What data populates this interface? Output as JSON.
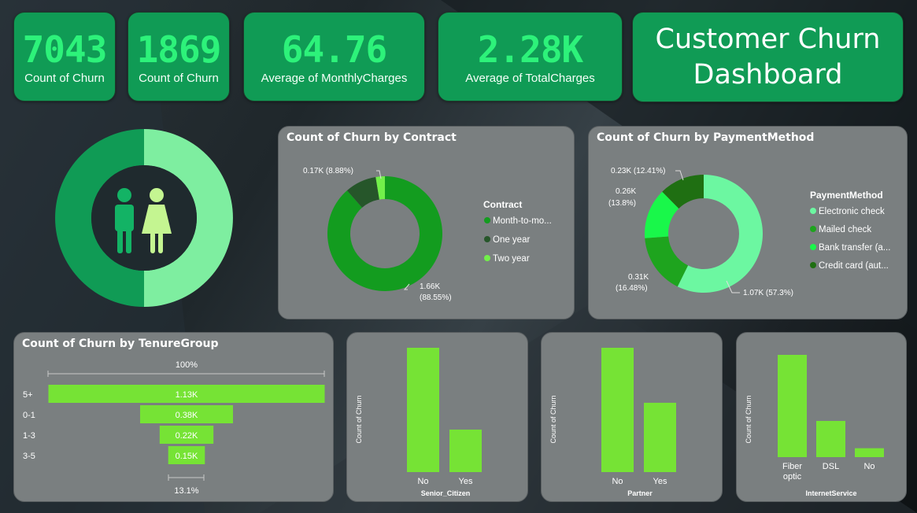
{
  "kpis": [
    {
      "value": "7043",
      "label": "Count of Churn"
    },
    {
      "value": "1869",
      "label": "Count of Churn"
    },
    {
      "value": "64.76",
      "label": "Average of MonthlyCharges"
    },
    {
      "value": "2.28K",
      "label": "Average of TotalCharges"
    }
  ],
  "title": {
    "line1": "Customer Churn",
    "line2": "Dashboard"
  },
  "colors": {
    "accent": "#109b55",
    "kpi_value": "#2df27a",
    "bar": "#76e335",
    "panel": "#7a7f80"
  },
  "icons": {
    "gender": "male-female-icon"
  },
  "chart_data": [
    {
      "type": "pie",
      "variant": "donut",
      "categories": [
        "",
        ""
      ],
      "values": [
        50,
        50
      ],
      "colors": [
        "#109b55",
        "#7eeea0"
      ]
    },
    {
      "type": "pie",
      "variant": "donut",
      "title": "Count of Churn by Contract",
      "legend_title": "Contract",
      "categories": [
        "Month-to-mo...",
        "One year",
        "Two year"
      ],
      "values": [
        1655,
        166,
        48
      ],
      "colors": [
        "#139c1f",
        "#26562a",
        "#72f04a"
      ],
      "data_labels": [
        "1.66K",
        "(88.55%)",
        "0.17K (8.88%)"
      ]
    },
    {
      "type": "pie",
      "variant": "donut",
      "title": "Count of Churn by PaymentMethod",
      "legend_title": "PaymentMethod",
      "categories": [
        "Electronic check",
        "Mailed check",
        "Bank transfer (a...",
        "Credit card (aut..."
      ],
      "values": [
        1071,
        308,
        258,
        232
      ],
      "colors": [
        "#6cf7a1",
        "#1ea41e",
        "#19f74a",
        "#1f6f12"
      ],
      "data_labels": [
        "1.07K (57.3%)",
        "0.31K",
        "(16.48%)",
        "0.26K",
        "(13.8%)",
        "0.23K (12.41%)"
      ]
    },
    {
      "type": "bar",
      "variant": "funnel",
      "title": "Count of Churn by TenureGroup",
      "categories": [
        "5+",
        "0-1",
        "1-3",
        "3-5"
      ],
      "values": [
        1130,
        380,
        220,
        150
      ],
      "data_labels": [
        "1.13K",
        "0.38K",
        "0.22K",
        "0.15K"
      ],
      "top_label": "100%",
      "bottom_label": "13.1%"
    },
    {
      "type": "bar",
      "categories": [
        "No",
        "Yes"
      ],
      "values": [
        1393,
        476
      ],
      "xlabel": "Senior_Citizen",
      "ylabel": "Count of Churn",
      "ylim": [
        0,
        1393
      ]
    },
    {
      "type": "bar",
      "categories": [
        "No",
        "Yes"
      ],
      "values": [
        1200,
        669
      ],
      "xlabel": "Partner",
      "ylabel": "Count of Churn",
      "ylim": [
        0,
        1200
      ]
    },
    {
      "type": "bar",
      "categories": [
        "Fiber optic",
        "DSL",
        "No"
      ],
      "values": [
        1297,
        459,
        113
      ],
      "xlabel": "InternetService",
      "ylabel": "Count of Churn",
      "ylim": [
        0,
        1297
      ]
    }
  ]
}
